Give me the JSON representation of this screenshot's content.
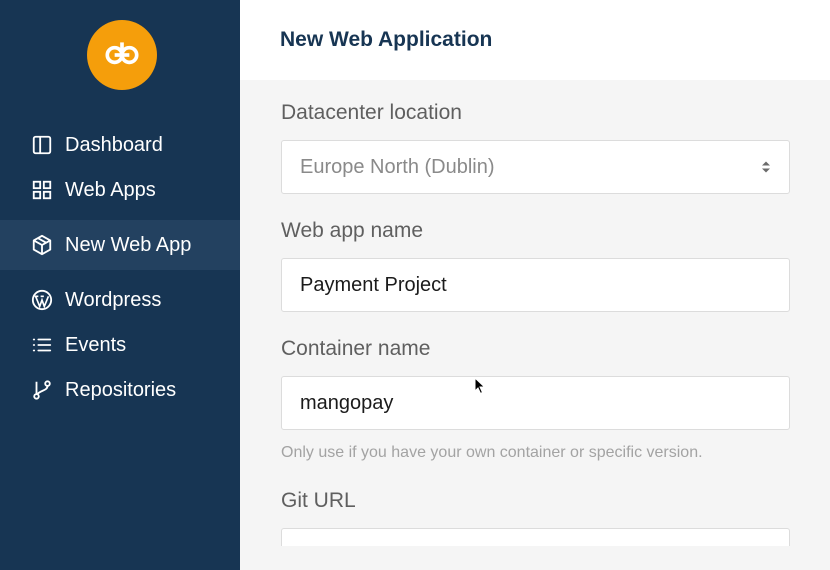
{
  "sidebar": {
    "logo_icon": "logo-icon",
    "items": [
      {
        "label": "Dashboard",
        "icon": "columns-icon",
        "active": false
      },
      {
        "label": "Web Apps",
        "icon": "grid-icon",
        "active": false
      },
      {
        "label": "New Web App",
        "icon": "box-icon",
        "active": true
      },
      {
        "label": "Wordpress",
        "icon": "wordpress-icon",
        "active": false
      },
      {
        "label": "Events",
        "icon": "list-icon",
        "active": false
      },
      {
        "label": "Repositories",
        "icon": "git-branch-icon",
        "active": false
      }
    ]
  },
  "header": {
    "title": "New Web Application"
  },
  "form": {
    "datacenter": {
      "label": "Datacenter location",
      "value": "Europe North (Dublin)"
    },
    "app_name": {
      "label": "Web app name",
      "value": "Payment Project"
    },
    "container": {
      "label": "Container name",
      "value": "mangopay",
      "hint": "Only use if you have your own container or specific version."
    },
    "git": {
      "label": "Git URL",
      "value": ""
    }
  },
  "colors": {
    "sidebar_bg": "#173553",
    "sidebar_active": "#234160",
    "logo_bg": "#f59e0b",
    "title": "#173553"
  }
}
